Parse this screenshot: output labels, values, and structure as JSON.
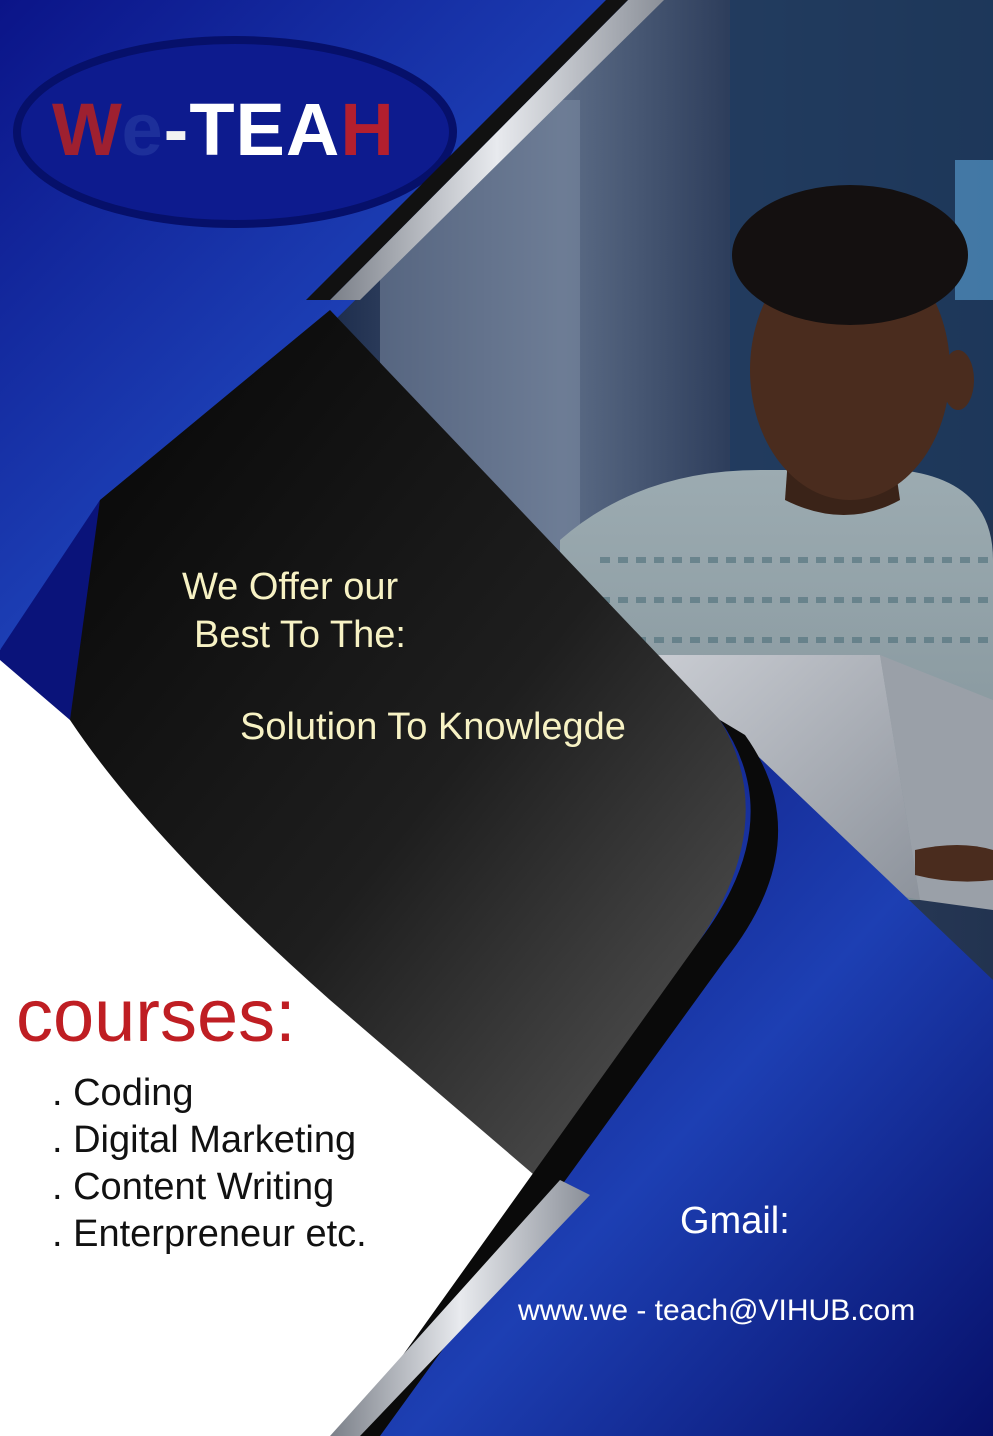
{
  "brand": {
    "logo_letters": [
      "W",
      "e",
      "-",
      "TEA",
      "H"
    ]
  },
  "hero": {
    "offer_line1": "We Offer our",
    "offer_line2": "Best To The:",
    "tagline": "Solution To Knowlegde"
  },
  "courses": {
    "title": "courses:",
    "items": [
      ". Coding",
      ". Digital Marketing",
      ". Content Writing",
      ". Enterpreneur etc."
    ]
  },
  "contact": {
    "label": "Gmail:",
    "email": "www.we - teach@VIHUB.com"
  },
  "colors": {
    "navy": "#0a137a",
    "royal_blue": "#1b3fb0",
    "black_panel": "#111111",
    "accent_red": "#bf1e23",
    "cream_text": "#f7f2c4"
  },
  "icons": [
    "person-with-laptop-photo"
  ]
}
